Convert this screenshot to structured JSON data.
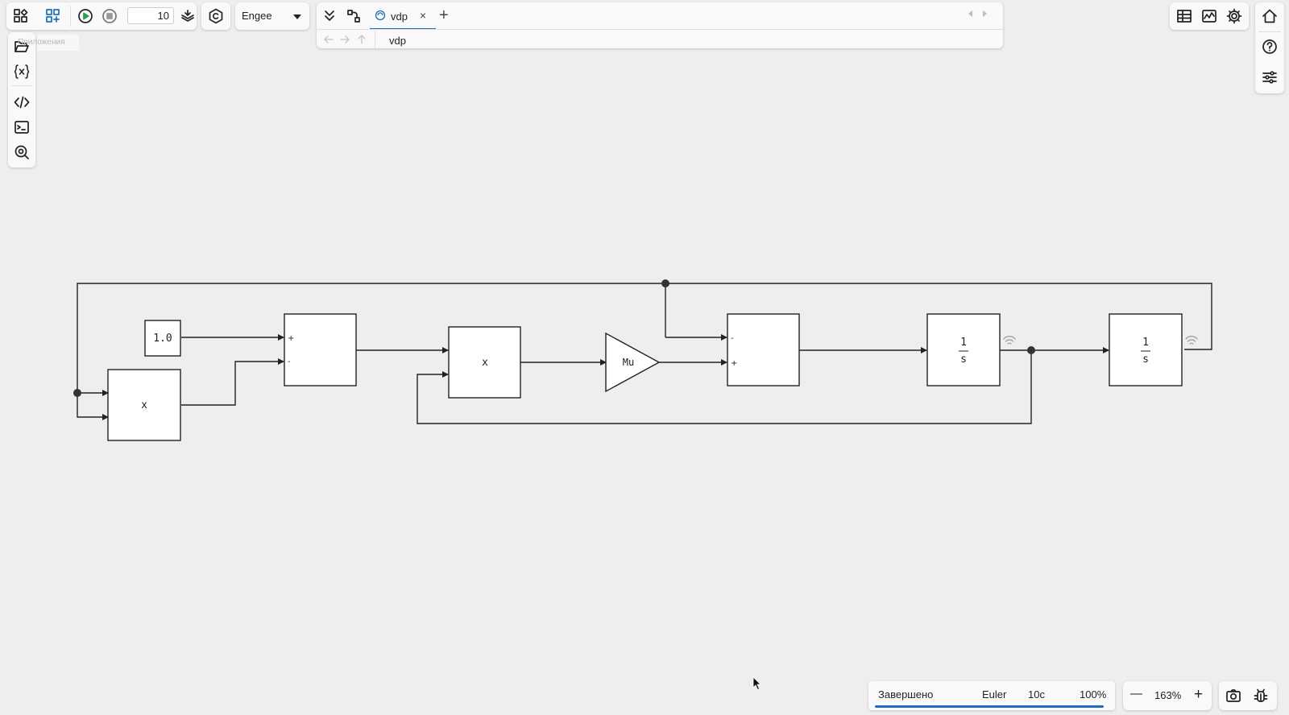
{
  "toolbar": {
    "stop_time": "10",
    "solver": "Engee"
  },
  "tabs": [
    {
      "label": "vdp",
      "close": "×"
    }
  ],
  "add_tab": "+",
  "breadcrumb": "vdp",
  "left_sidebar": {
    "tooltip": "Приложения"
  },
  "diagram": {
    "constant_value": "1.0",
    "product_top_label": "x",
    "product_bottom_label": "x",
    "gain_label": "Mu",
    "sum1_signs": [
      "+",
      "-"
    ],
    "sum2_signs": [
      "-",
      "+"
    ],
    "integrator1_num": "1",
    "integrator1_den": "s",
    "integrator2_num": "1",
    "integrator2_den": "s"
  },
  "status": {
    "state": "Завершено",
    "solver": "Euler",
    "sim_time": "10с",
    "progress": "100%",
    "progress_fraction": 1.0
  },
  "zoom": {
    "minus": "—",
    "value": "163%",
    "plus": "+"
  },
  "colors": {
    "accent": "#1e6fb9",
    "canvas": "#eeeeee",
    "run_green": "#2a9d4f"
  }
}
